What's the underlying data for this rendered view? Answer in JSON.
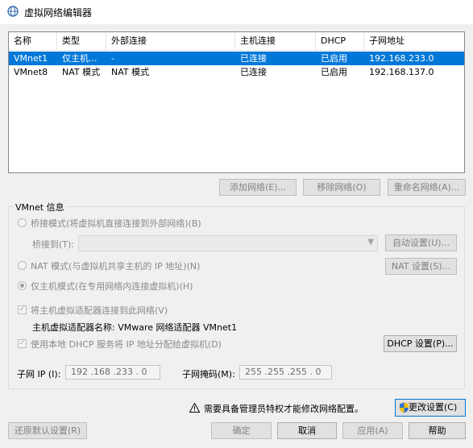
{
  "window": {
    "title": "虚拟网络编辑器"
  },
  "table": {
    "headers": [
      "名称",
      "类型",
      "外部连接",
      "主机连接",
      "DHCP",
      "子网地址"
    ],
    "rows": [
      [
        "VMnet1",
        "仅主机...",
        "-",
        "已连接",
        "已启用",
        "192.168.233.0"
      ],
      [
        "VMnet8",
        "NAT 模式",
        "NAT 模式",
        "已连接",
        "已启用",
        "192.168.137.0"
      ]
    ],
    "selected_row": 0
  },
  "actions": {
    "add_network": "添加网络(E)...",
    "remove_network": "移除网络(O)",
    "rename_network": "重命名网络(A)..."
  },
  "vmnet": {
    "group_label": "VMnet 信息",
    "bridge_mode": "桥接模式(将虚拟机直接连接到外部网络)(B)",
    "bridge_to_label": "桥接到(T):",
    "auto_settings": "自动设置(U)...",
    "nat_mode": "NAT 模式(与虚拟机共享主机的 IP 地址)(N)",
    "nat_settings": "NAT 设置(S)...",
    "host_only_mode": "仅主机模式(在专用网络内连接虚拟机)(H)",
    "connect_adapter": "将主机虚拟适配器连接到此网络(V)",
    "adapter_name": "主机虚拟适配器名称: VMware 网络适配器 VMnet1",
    "use_dhcp": "使用本地 DHCP 服务将 IP 地址分配给虚拟机(D)",
    "dhcp_settings": "DHCP 设置(P)...",
    "subnet_ip_label": "子网 IP (I):",
    "subnet_ip": "192 .168 .233 .  0",
    "subnet_mask_label": "子网掩码(M):",
    "subnet_mask": "255 .255 .255 .  0"
  },
  "notice": {
    "text": "需要具备管理员特权才能修改网络配置。",
    "change_settings": "更改设置(C)"
  },
  "footer": {
    "restore_defaults": "还原默认设置(R)",
    "ok": "确定",
    "cancel": "取消",
    "apply": "应用(A)",
    "help": "帮助"
  },
  "colors": {
    "selection": "#0078d7",
    "shield_blue": "#2f6fd1",
    "shield_yellow": "#f2c413"
  }
}
